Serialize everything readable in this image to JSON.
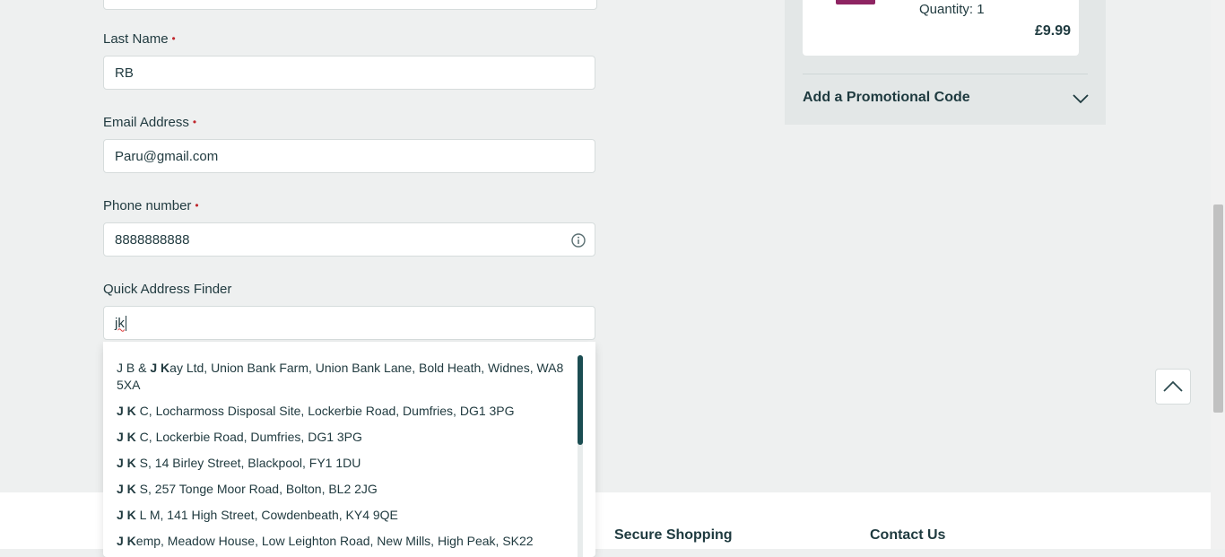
{
  "form": {
    "last_name": {
      "label": "Last Name",
      "required_mark": "•",
      "value": "RB"
    },
    "email": {
      "label": "Email Address",
      "required_mark": "•",
      "value": "Paru@gmail.com"
    },
    "phone": {
      "label": "Phone number",
      "required_mark": "•",
      "value": "8888888888",
      "icon": "info-icon"
    },
    "address_finder": {
      "label": "Quick Address Finder",
      "value": "jk"
    }
  },
  "suggestions": [
    {
      "pre": "J B & ",
      "bold": "J K",
      "rest": "ay Ltd, Union Bank Farm, Union Bank Lane, Bold Heath, Widnes, WA8 5XA"
    },
    {
      "pre": "",
      "bold": "J K",
      "rest": " C, Locharmoss Disposal Site, Lockerbie Road, Dumfries, DG1 3PG"
    },
    {
      "pre": "",
      "bold": "J K",
      "rest": " C, Lockerbie Road, Dumfries, DG1 3PG"
    },
    {
      "pre": "",
      "bold": "J K",
      "rest": " S, 14 Birley Street, Blackpool, FY1 1DU"
    },
    {
      "pre": "",
      "bold": "J K",
      "rest": " S, 257 Tonge Moor Road, Bolton, BL2 2JG"
    },
    {
      "pre": "",
      "bold": "J K",
      "rest": " L M, 141 High Street, Cowdenbeath, KY4 9QE"
    },
    {
      "pre": "",
      "bold": "J K",
      "rest": "emp, Meadow House, Low Leighton Road, New Mills, High Peak, SK22"
    }
  ],
  "order_summary": {
    "quantity": "Quantity: 1",
    "price": "£9.99",
    "promo_label": "Add a Promotional Code"
  },
  "footer": {
    "secure_shopping": "Secure Shopping",
    "contact_us": "Contact Us"
  },
  "colors": {
    "page_bg": "#eef0f0",
    "required": "#c0272d",
    "dropdown_scroll_thumb": "#1b4d52",
    "product_thumb": "#8e2462"
  }
}
